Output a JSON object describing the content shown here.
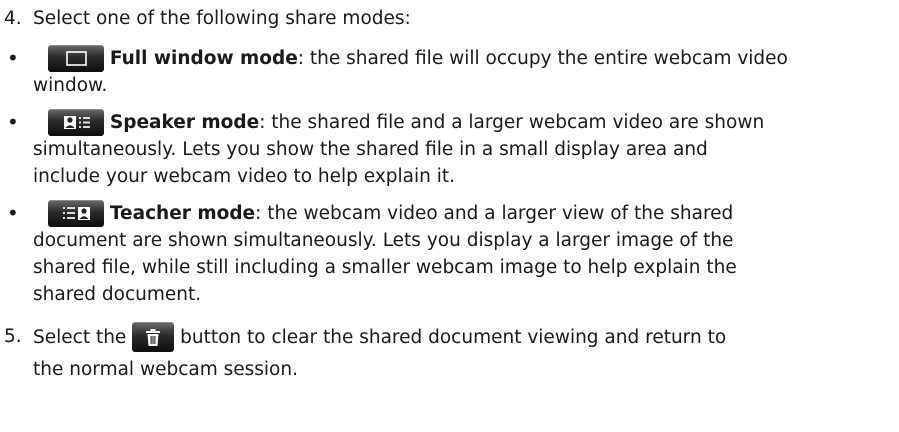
{
  "step4": {
    "number": "4.",
    "text": "Select one of the following share modes:"
  },
  "modes": [
    {
      "icon": "full-window-mode-icon",
      "title": "Full window mode",
      "line1": ": the shared file will occupy the entire webcam video",
      "line2": "window."
    },
    {
      "icon": "speaker-mode-icon",
      "title": "Speaker mode",
      "line1": ": the shared file and a larger webcam video are shown",
      "line2": "simultaneously. Lets you show the shared file in a small display area and",
      "line3": "include your webcam video to help explain it."
    },
    {
      "icon": "teacher-mode-icon",
      "title": "Teacher mode",
      "line1": ": the webcam video and a larger view of the shared",
      "line2": "document are shown simultaneously. Lets you display a larger image of the",
      "line3": "shared file, while still including a smaller webcam image to help explain the",
      "line4": "shared document."
    }
  ],
  "step5": {
    "number": "5.",
    "before": "Select the",
    "icon": "trash-icon",
    "after": "button to clear the shared document viewing and return to",
    "line2": "the normal webcam session."
  },
  "bullet": "•"
}
